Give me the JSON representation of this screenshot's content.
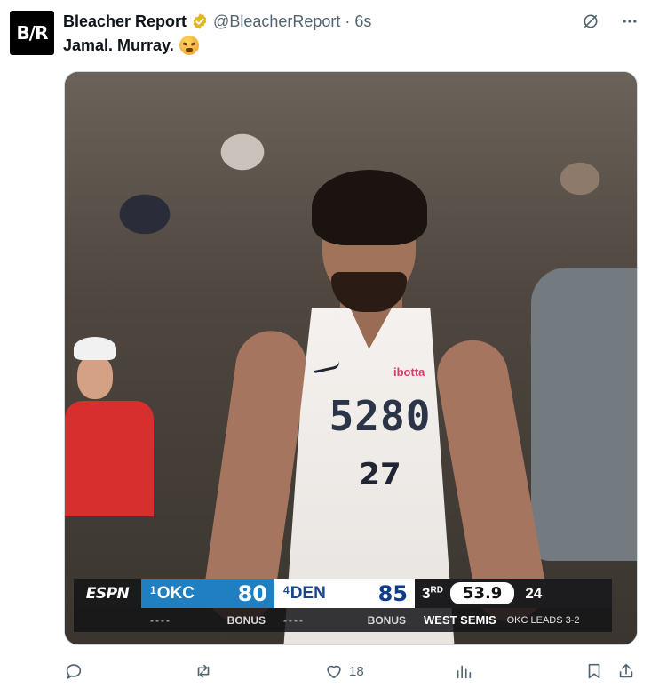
{
  "tweet": {
    "author_name": "Bleacher Report",
    "avatar_text": "B/R",
    "handle": "@BleacherReport",
    "separator": "·",
    "time": "6s",
    "text": "Jamal. Murray.",
    "emoji": "steam-from-nose-emoji",
    "verified_color": "#e2b719"
  },
  "media": {
    "jersey_number_front": "5280",
    "jersey_number": "27",
    "jersey_sponsor": "ibotta",
    "scorebug": {
      "network": "ESPN",
      "away": {
        "seed": "1",
        "abbr": "OKC",
        "score": "80",
        "bonus": "BONUS",
        "color": "#1f7fc1"
      },
      "home": {
        "seed": "4",
        "abbr": "DEN",
        "score": "85",
        "bonus": "BONUS",
        "color": "#ffffff"
      },
      "period": "3",
      "period_suffix": "RD",
      "clock": "53.9",
      "shot_clock": "24",
      "dashes": "----",
      "series": "WEST SEMIS",
      "series_status": "OKC LEADS 3-2"
    }
  },
  "actions": {
    "reply_count": "",
    "retweet_count": "",
    "like_count": "18",
    "views_count": ""
  },
  "icons": [
    "grok-icon",
    "more-icon",
    "reply-icon",
    "retweet-icon",
    "like-icon",
    "views-icon",
    "bookmark-icon",
    "share-icon"
  ]
}
